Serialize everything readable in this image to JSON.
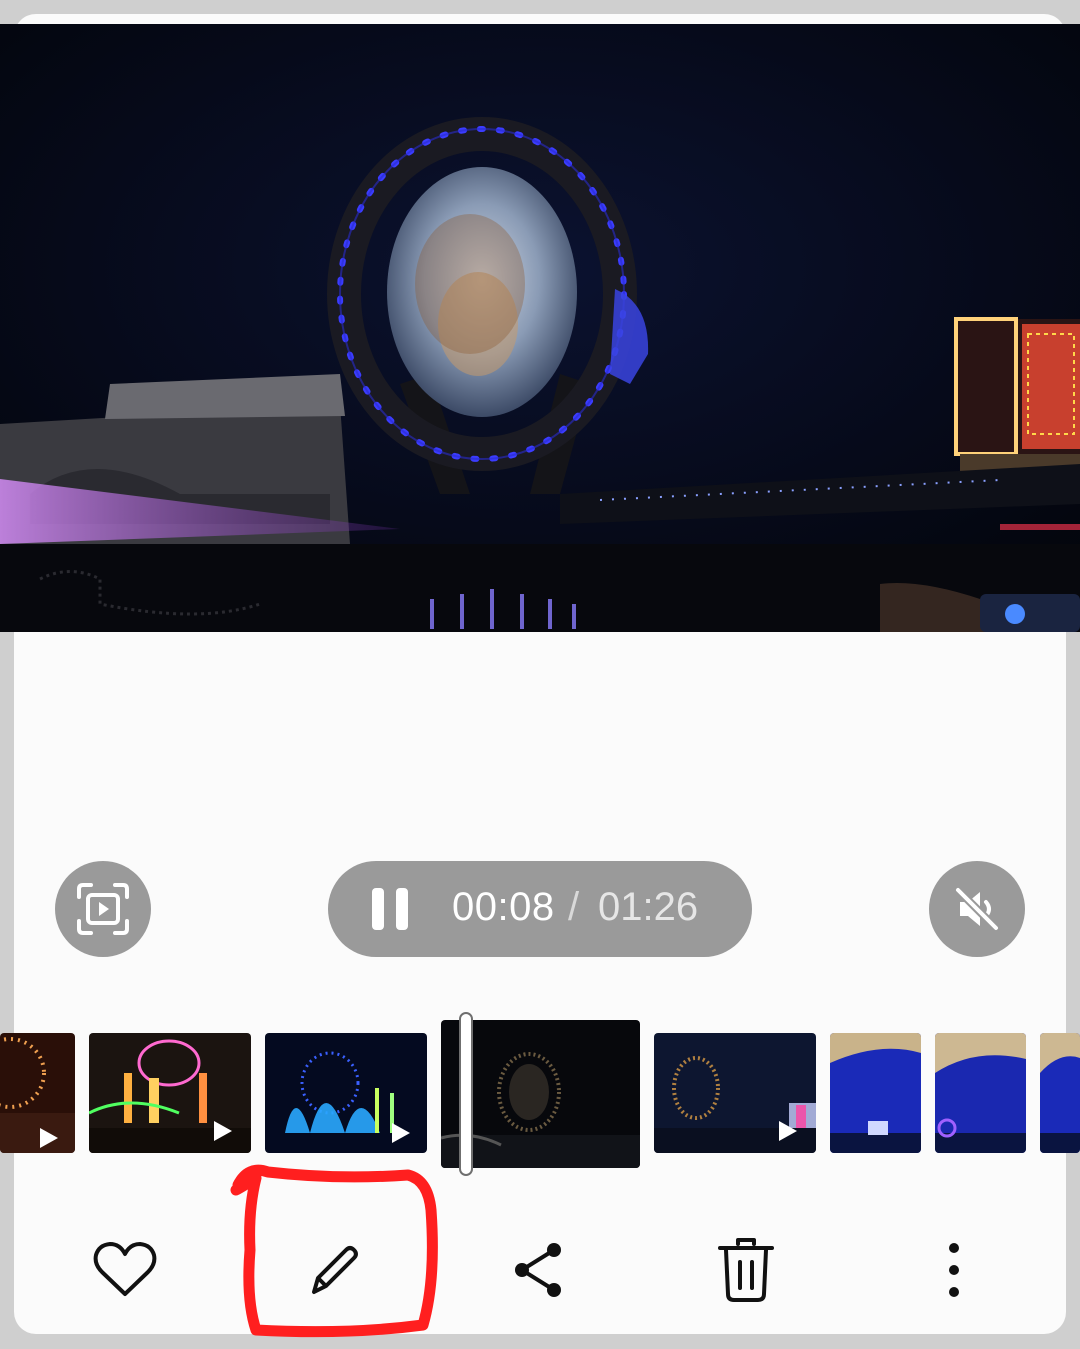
{
  "player": {
    "current_time": "00:08",
    "separator": "/",
    "total_time": "01:26",
    "state": "playing",
    "muted": true
  },
  "icons": {
    "capture": "video-capture-icon",
    "pause": "pause-icon",
    "mute": "volume-muted-icon",
    "favorite": "heart-icon",
    "edit": "pencil-icon",
    "share": "share-icon",
    "delete": "trash-icon",
    "more": "more-vertical-icon"
  },
  "filmstrip": {
    "thumbnails": [
      {
        "kind": "video",
        "scene": "ferris-wheel-red"
      },
      {
        "kind": "video",
        "scene": "fountain-colorful"
      },
      {
        "kind": "video",
        "scene": "fountain-blue"
      },
      {
        "kind": "video",
        "scene": "ring-night",
        "active": true
      },
      {
        "kind": "video",
        "scene": "ring-hotel"
      },
      {
        "kind": "image",
        "scene": "blue-sky-1"
      },
      {
        "kind": "image",
        "scene": "blue-sky-2"
      },
      {
        "kind": "image",
        "scene": "blue-sky-3"
      }
    ]
  },
  "annotation": {
    "color": "#ff1f1f",
    "target": "edit-button"
  },
  "colors": {
    "control_bg": "#9a9a9a",
    "background": "#fbfbfb"
  }
}
